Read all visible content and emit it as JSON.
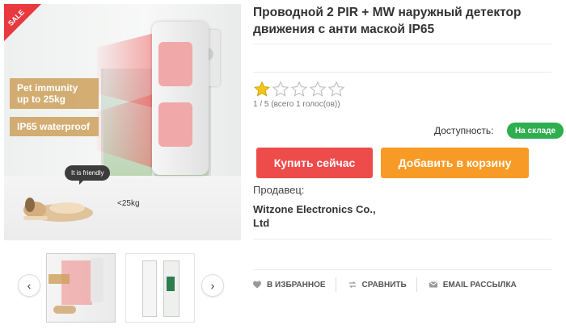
{
  "product": {
    "title": "Проводной 2 PIR + MW наружный детектор движения с анти маской IP65",
    "rating": 1,
    "rating_max": 5,
    "rating_text": "1 / 5 (всего 1 голос(ов))",
    "availability_label": "Доступность:",
    "availability_status": "На складе",
    "buy_now_label": "Купить сейчас",
    "add_to_cart_label": "Добавить в корзину",
    "seller_label": "Продавец:",
    "seller_name": "Witzone Electronics Co., Ltd"
  },
  "image": {
    "sale_badge": "SALE",
    "feature_1": "Pet immunity up to 25kg",
    "feature_2": "IP65 waterproof",
    "bubble": "It is friendly",
    "weight": "<25kg"
  },
  "thumbnails": {
    "prev_icon": "chevron-left-icon",
    "next_icon": "chevron-right-icon",
    "prev_glyph": "‹",
    "next_glyph": "›"
  },
  "actions": [
    {
      "label": "В ИЗБРАННОЕ",
      "icon": "heart-icon"
    },
    {
      "label": "СРАВНИТЬ",
      "icon": "compare-icon"
    },
    {
      "label": "EMAIL РАССЫЛКА",
      "icon": "mail-icon"
    }
  ],
  "colors": {
    "buy_button": "#ee4b4b",
    "cart_button": "#f89b26",
    "stock_badge": "#2fae4f",
    "star_filled": "#f5c518",
    "sale": "#e8393f"
  }
}
